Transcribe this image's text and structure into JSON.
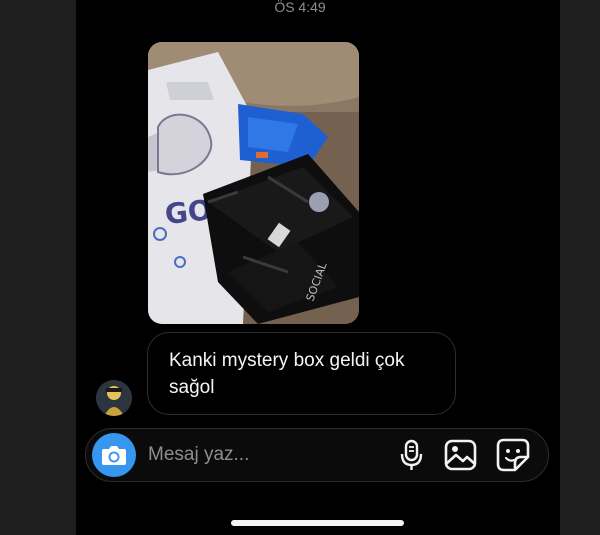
{
  "status": {
    "time": "ÖS 4:49"
  },
  "messages": [
    {
      "type": "photo",
      "icon": "photo-clothing-package"
    },
    {
      "type": "text",
      "text": "Kanki mystery box geldi çok sağol"
    }
  ],
  "composer": {
    "placeholder": "Mesaj yaz...",
    "accent": "#3797f0",
    "icons": [
      "camera-icon",
      "microphone-icon",
      "gallery-icon",
      "sticker-icon"
    ]
  }
}
